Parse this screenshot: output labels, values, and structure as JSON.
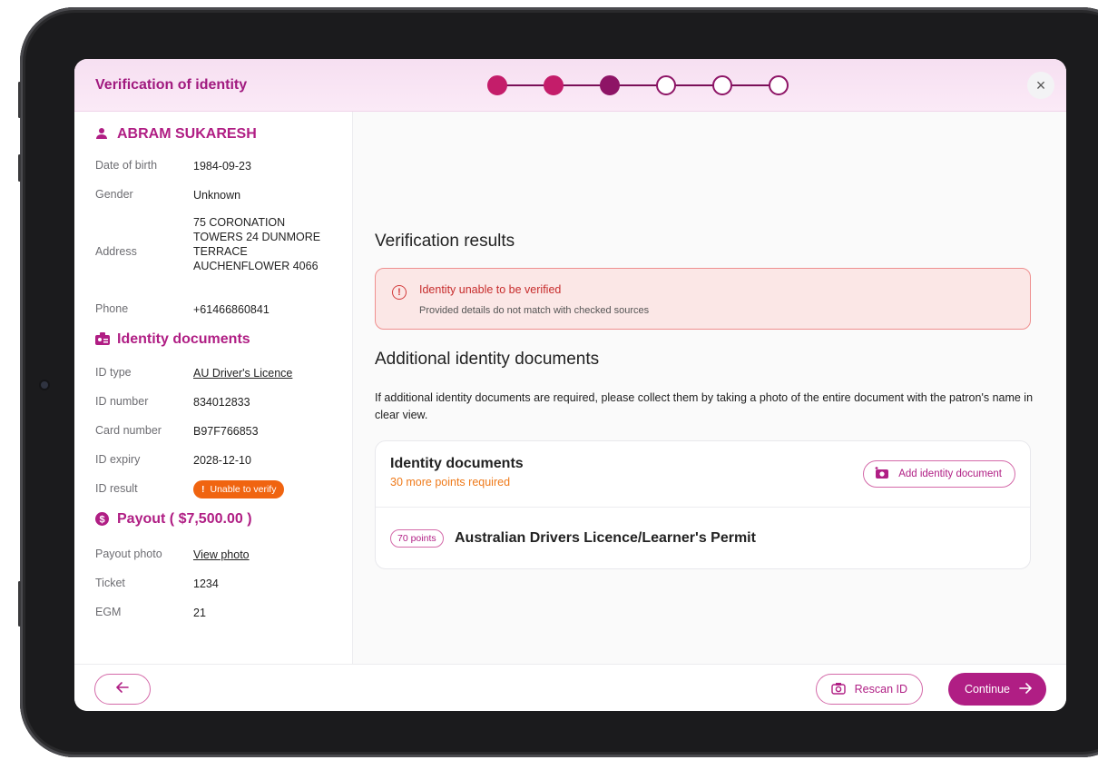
{
  "header": {
    "title": "Verification of identity",
    "close_label": "×",
    "steps": [
      "done",
      "done",
      "current",
      "pending",
      "pending",
      "pending"
    ]
  },
  "sidebar": {
    "patron": {
      "name": "ABRAM SUKARESH",
      "icon": "person-icon",
      "fields": [
        {
          "label": "Date of birth",
          "value": "1984-09-23"
        },
        {
          "label": "Gender",
          "value": "Unknown"
        },
        {
          "label": "Address",
          "value_lines": [
            "75 CORONATION",
            "TOWERS 24 DUNMORE",
            "TERRACE",
            "AUCHENFLOWER 4066"
          ]
        },
        {
          "label": "Phone",
          "value": "+61466860841"
        }
      ]
    },
    "identity": {
      "title": "Identity documents",
      "icon": "id-card-icon",
      "fields": [
        {
          "label": "ID type",
          "value": "AU Driver's Licence"
        },
        {
          "label": "ID number",
          "value": "834012833"
        },
        {
          "label": "Card number",
          "value": "B97F766853"
        },
        {
          "label": "ID expiry",
          "value": "2028-12-10"
        },
        {
          "label": "ID result",
          "value": "Unable to verify"
        }
      ]
    },
    "payout": {
      "title": "Payout ( $7,500.00 )",
      "icon": "dollar-icon",
      "fields": [
        {
          "label": "Payout photo",
          "value": "View photo"
        },
        {
          "label": "Ticket",
          "value": "1234"
        },
        {
          "label": "EGM",
          "value": "21"
        }
      ]
    }
  },
  "main": {
    "results_title": "Verification results",
    "alert": {
      "title": "Identity unable to be verified",
      "description": "Provided details do not match with checked sources",
      "icon_glyph": "!"
    },
    "additional_title": "Additional identity documents",
    "instruction": "If additional identity documents are required, please collect them by taking a photo of the entire document with the patron's name in clear view.",
    "card": {
      "title": "Identity documents",
      "subtitle": "30 more points required",
      "add_label": "Add identity document",
      "document": {
        "points": "70 points",
        "name": "Australian Drivers Licence/Learner's Permit"
      }
    }
  },
  "footer": {
    "rescan_label": "Rescan ID",
    "continue_label": "Continue"
  },
  "colors": {
    "accent": "#b01e84",
    "step_done": "#c41d6a",
    "step_current": "#8e1466",
    "error": "#c72c2c",
    "warning": "#ef7a1a"
  }
}
